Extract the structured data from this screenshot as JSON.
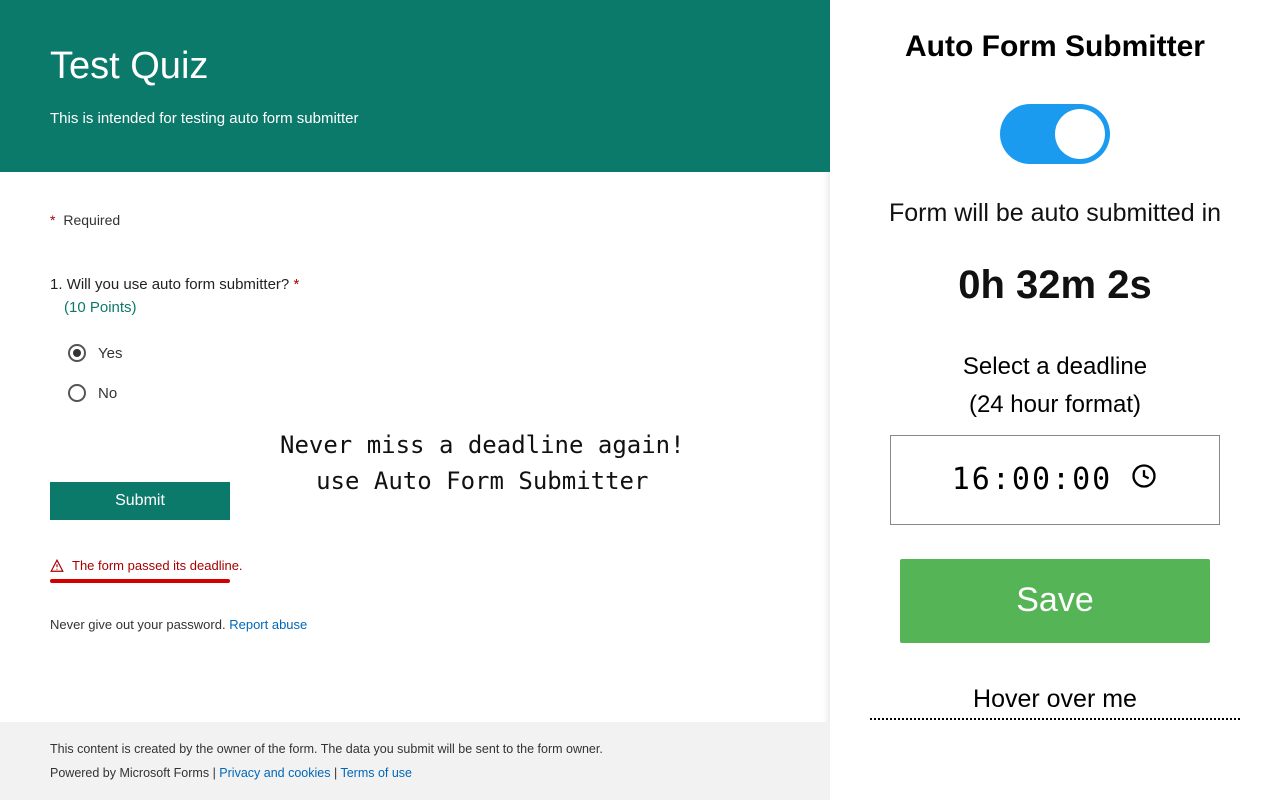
{
  "form": {
    "title": "Test Quiz",
    "description": "This is intended for testing auto form submitter",
    "required_label": "Required",
    "question": {
      "number": "1.",
      "text": "Will you use auto form submitter?",
      "points": "(10 Points)",
      "options": [
        {
          "label": "Yes",
          "selected": true
        },
        {
          "label": "No",
          "selected": false
        }
      ]
    },
    "submit_label": "Submit",
    "error_text": "The form passed its deadline.",
    "info_text": "Never give out your password.",
    "report_link": "Report abuse"
  },
  "promo": {
    "line1": "Never miss a deadline again!",
    "line2": "use Auto Form Submitter"
  },
  "footer": {
    "line1": "This content is created by the owner of the form. The data you submit will be sent to the form owner.",
    "powered": "Powered by Microsoft Forms",
    "links": {
      "privacy": "Privacy and cookies",
      "terms": "Terms of use"
    }
  },
  "panel": {
    "title": "Auto Form Submitter",
    "toggle_on": true,
    "auto_message": "Form will be auto submitted in",
    "countdown": "0h 32m 2s",
    "deadline_label": "Select a deadline",
    "deadline_format": "(24 hour format)",
    "time_value": "16:00:00",
    "save_label": "Save",
    "hover_text": "Hover over me"
  }
}
